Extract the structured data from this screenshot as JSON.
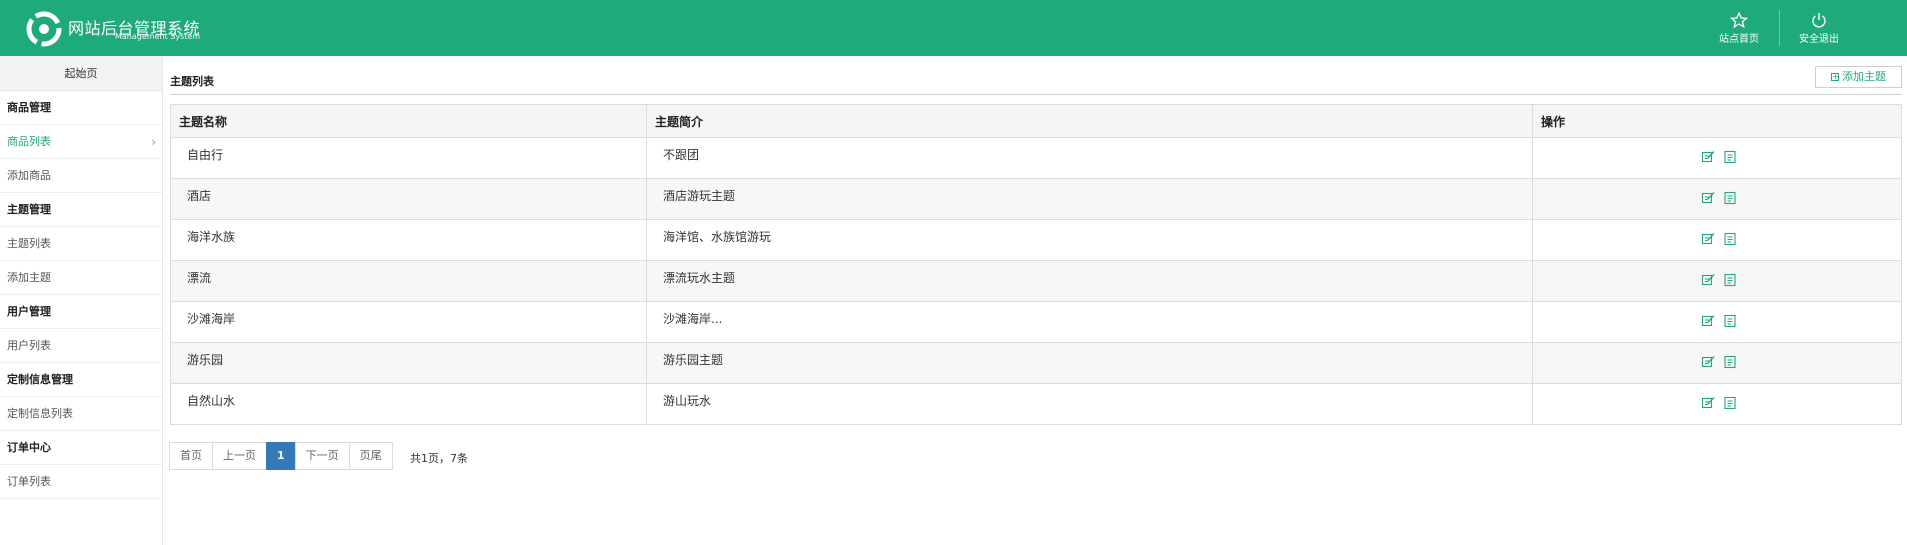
{
  "header": {
    "title": "网站后台管理系统",
    "subtitle": "Management System",
    "home_label": "站点首页",
    "logout_label": "安全退出",
    "bg_color": "#1faa7a"
  },
  "sidebar": {
    "start_label": "起始页",
    "groups": [
      {
        "title": "商品管理",
        "items": [
          "商品列表",
          "添加商品"
        ]
      },
      {
        "title": "主题管理",
        "items": [
          "主题列表",
          "添加主题"
        ]
      },
      {
        "title": "用户管理",
        "items": [
          "用户列表"
        ]
      },
      {
        "title": "定制信息管理",
        "items": [
          "定制信息列表"
        ]
      },
      {
        "title": "订单中心",
        "items": [
          "订单列表"
        ]
      }
    ],
    "active_item": "商品列表"
  },
  "main": {
    "title": "主题列表",
    "add_button_label": "添加主题",
    "columns": [
      "主题名称",
      "主题简介",
      "操作"
    ],
    "rows": [
      {
        "name": "自由行",
        "desc": "不跟团"
      },
      {
        "name": "酒店",
        "desc": "酒店游玩主题"
      },
      {
        "name": "海洋水族",
        "desc": "海洋馆、水族馆游玩"
      },
      {
        "name": "漂流",
        "desc": "漂流玩水主题"
      },
      {
        "name": "沙滩海岸",
        "desc": "沙滩海岸..."
      },
      {
        "name": "游乐园",
        "desc": "游乐园主题"
      },
      {
        "name": "自然山水",
        "desc": "游山玩水"
      }
    ],
    "row_actions": [
      "edit-icon",
      "delete-icon"
    ]
  },
  "pagination": {
    "first": "首页",
    "prev": "上一页",
    "current": "1",
    "next": "下一页",
    "last": "页尾",
    "info": "共1页，7条"
  }
}
